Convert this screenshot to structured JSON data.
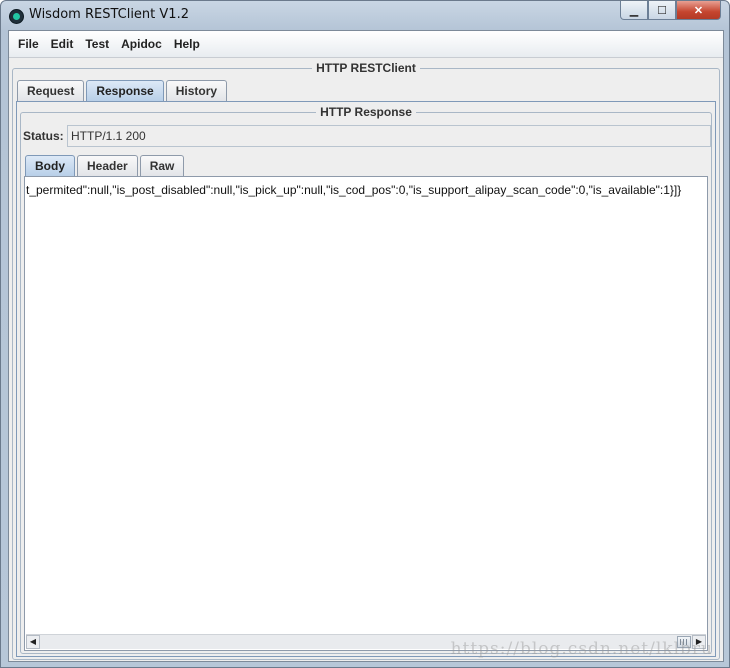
{
  "window": {
    "title": "Wisdom RESTClient V1.2",
    "buttons": {
      "minimize": "▁",
      "maximize": "☐",
      "close": "✕"
    }
  },
  "menu": [
    "File",
    "Edit",
    "Test",
    "Apidoc",
    "Help"
  ],
  "main_group_title": "HTTP RESTClient",
  "main_tabs": [
    {
      "label": "Request",
      "active": false
    },
    {
      "label": "Response",
      "active": true
    },
    {
      "label": "History",
      "active": false
    }
  ],
  "response": {
    "group_title": "HTTP Response",
    "status_label": "Status:",
    "status_value": "HTTP/1.1 200",
    "tabs": [
      {
        "label": "Body",
        "active": true
      },
      {
        "label": "Header",
        "active": false
      },
      {
        "label": "Raw",
        "active": false
      }
    ],
    "body_text": "t_permited\":null,\"is_post_disabled\":null,\"is_pick_up\":null,\"is_cod_pos\":0,\"is_support_alipay_scan_code\":0,\"is_available\":1}]}"
  },
  "scrollbar": {
    "left_arrow": "◀",
    "right_arrow": "▶"
  },
  "watermark": "https://blog.csdn.net/lklbru"
}
